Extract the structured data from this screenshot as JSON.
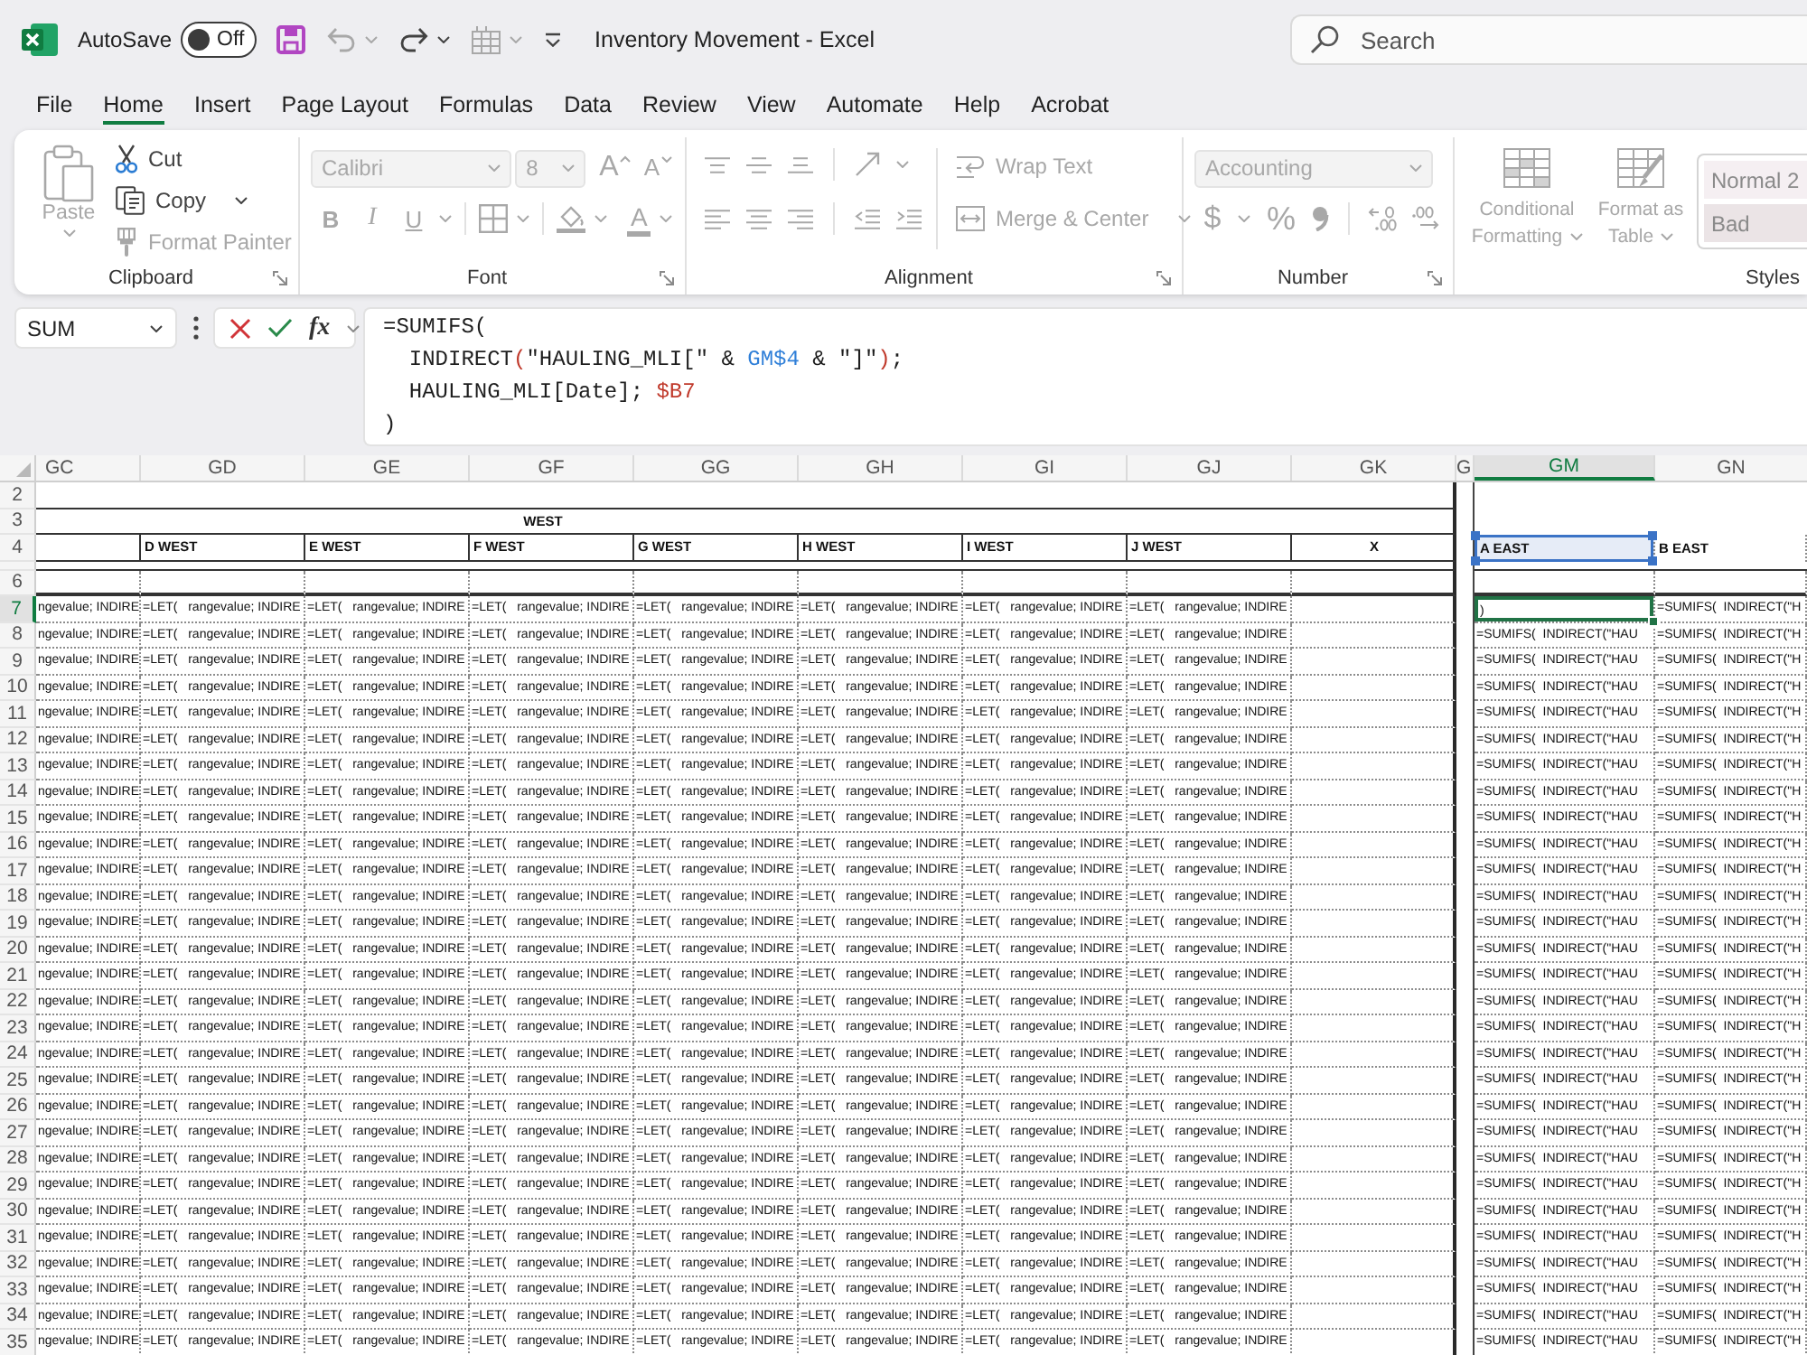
{
  "title_bar": {
    "autosave": {
      "label": "AutoSave",
      "on": false,
      "state_label": "Off"
    },
    "quick_access": [
      {
        "kind": "save",
        "disabled": false
      },
      {
        "kind": "undo",
        "disabled": true
      },
      {
        "kind": "redo",
        "disabled": false
      },
      {
        "kind": "table",
        "disabled": true
      },
      {
        "kind": "customize",
        "disabled": false
      }
    ],
    "title": "Inventory Movement - Excel",
    "search": {
      "placeholder": "Search"
    }
  },
  "menu_tabs": [
    {
      "label": "File",
      "selected": false
    },
    {
      "label": "Home",
      "selected": true
    },
    {
      "label": "Insert",
      "selected": false
    },
    {
      "label": "Page Layout",
      "selected": false
    },
    {
      "label": "Formulas",
      "selected": false
    },
    {
      "label": "Data",
      "selected": false
    },
    {
      "label": "Review",
      "selected": false
    },
    {
      "label": "View",
      "selected": false
    },
    {
      "label": "Automate",
      "selected": false
    },
    {
      "label": "Help",
      "selected": false
    },
    {
      "label": "Acrobat",
      "selected": false
    }
  ],
  "ribbon": {
    "clipboard": {
      "label": "Clipboard",
      "paste": {
        "label": "Paste",
        "disabled": true
      },
      "cut": {
        "label": "Cut",
        "disabled": false
      },
      "copy": {
        "label": "Copy",
        "disabled": false
      },
      "format_painter": {
        "label": "Format Painter",
        "disabled": true
      }
    },
    "font": {
      "label": "Font",
      "font_name": {
        "value": "Calibri",
        "disabled": true
      },
      "font_size": {
        "value": "8",
        "disabled": true
      },
      "size_buttons": [
        {
          "kind": "grow",
          "label": "A",
          "disabled": true
        },
        {
          "kind": "shrink",
          "label": "A",
          "disabled": true
        }
      ],
      "style_buttons": [
        {
          "kind": "bold",
          "label": "B",
          "disabled": true
        },
        {
          "kind": "italic",
          "label": "I",
          "disabled": true
        },
        {
          "kind": "underline",
          "label": "U",
          "disabled": true
        }
      ],
      "tools": [
        {
          "kind": "borders",
          "disabled": true
        },
        {
          "kind": "fill_color",
          "disabled": true
        }
      ],
      "font_color": {
        "label": "A",
        "disabled": true
      }
    },
    "alignment": {
      "label": "Alignment",
      "tool_rows": [
        [
          {
            "kind": "align_top",
            "disabled": true
          },
          {
            "kind": "align_middle",
            "disabled": true
          },
          {
            "kind": "align_bottom",
            "disabled": true
          },
          {
            "kind": "orientation",
            "disabled": true
          }
        ],
        [
          {
            "kind": "align_left",
            "disabled": true
          },
          {
            "kind": "align_center",
            "disabled": true
          },
          {
            "kind": "align_right",
            "disabled": true
          },
          {
            "kind": "decrease_indent",
            "disabled": true
          },
          {
            "kind": "increase_indent",
            "disabled": true
          }
        ]
      ],
      "wrap_text": {
        "label": "Wrap Text",
        "disabled": true
      },
      "merge_center": {
        "label": "Merge & Center",
        "disabled": true
      }
    },
    "number": {
      "label": "Number",
      "format": {
        "value": "Accounting",
        "disabled": true
      },
      "currency": {
        "label": "$",
        "disabled": true
      },
      "percent": {
        "label": "%",
        "disabled": true
      },
      "tools": [
        {
          "kind": "comma",
          "disabled": true
        },
        {
          "kind": "increase_decimal",
          "disabled": true
        },
        {
          "kind": "decrease_decimal",
          "disabled": true
        }
      ]
    },
    "styles": {
      "label": "Styles",
      "conditional_formatting": {
        "label": "Conditional Formatting",
        "disabled": true
      },
      "format_as_table": {
        "label": "Format as Table",
        "disabled": true
      },
      "gallery": [
        {
          "label": "Normal 2",
          "color": "#f5eff2",
          "disabled": true
        },
        {
          "label": "Bad",
          "color": "#ebe4e6",
          "disabled": true
        }
      ]
    }
  },
  "formula_bar": {
    "name_box": "SUM",
    "function_label": "fx",
    "lines": [
      [
        {
          "text": "=SUMIFS(",
          "color": "#1e1e1e"
        }
      ],
      [
        {
          "text": "  INDIRECT",
          "color": "#1e1e1e"
        },
        {
          "text": "(",
          "color": "#c0392b"
        },
        {
          "text": "\"HAULING_MLI[\" & ",
          "color": "#1e1e1e"
        },
        {
          "text": "GM$4",
          "color": "#2f7fd8"
        },
        {
          "text": " & \"]\"",
          "color": "#1e1e1e"
        },
        {
          "text": ")",
          "color": "#c0392b"
        },
        {
          "text": ";",
          "color": "#1e1e1e"
        }
      ],
      [
        {
          "text": "  HAULING_MLI[Date]; ",
          "color": "#1e1e1e"
        },
        {
          "text": "$B7",
          "color": "#c0392b"
        }
      ],
      [
        {
          "text": ")",
          "color": "#1e1e1e"
        }
      ]
    ]
  },
  "sheet": {
    "group_title": "WEST",
    "columns": [
      {
        "label": "GC",
        "selected": false,
        "cells": [
          "ngevalue; INDIRE",
          "ngevalue; INDIRE",
          "ngevalue; INDIRE",
          "ngevalue; INDIRE",
          "ngevalue; INDIRE",
          "ngevalue; INDIRE",
          "ngevalue; INDIRE",
          "ngevalue; INDIRE",
          "ngevalue; INDIRE",
          "ngevalue; INDIRE",
          "ngevalue; INDIRE",
          "ngevalue; INDIRE",
          "ngevalue; INDIRE",
          "ngevalue; INDIRE",
          "ngevalue; INDIRE",
          "ngevalue; INDIRE",
          "ngevalue; INDIRE",
          "ngevalue; INDIRE",
          "ngevalue; INDIRE",
          "ngevalue; INDIRE",
          "ngevalue; INDIRE",
          "ngevalue; INDIRE",
          "ngevalue; INDIRE",
          "ngevalue; INDIRE",
          "ngevalue; INDIRE",
          "ngevalue; INDIRE",
          "ngevalue; INDIRE",
          "ngevalue; INDIRE",
          "ngevalue; INDIRE"
        ]
      },
      {
        "label": "GD",
        "selected": false,
        "header": {
          "text": "D WEST",
          "referenced": false
        },
        "cells": [
          "=LET(   rangevalue; INDIRE",
          "=LET(   rangevalue; INDIRE",
          "=LET(   rangevalue; INDIRE",
          "=LET(   rangevalue; INDIRE",
          "=LET(   rangevalue; INDIRE",
          "=LET(   rangevalue; INDIRE",
          "=LET(   rangevalue; INDIRE",
          "=LET(   rangevalue; INDIRE",
          "=LET(   rangevalue; INDIRE",
          "=LET(   rangevalue; INDIRE",
          "=LET(   rangevalue; INDIRE",
          "=LET(   rangevalue; INDIRE",
          "=LET(   rangevalue; INDIRE",
          "=LET(   rangevalue; INDIRE",
          "=LET(   rangevalue; INDIRE",
          "=LET(   rangevalue; INDIRE",
          "=LET(   rangevalue; INDIRE",
          "=LET(   rangevalue; INDIRE",
          "=LET(   rangevalue; INDIRE",
          "=LET(   rangevalue; INDIRE",
          "=LET(   rangevalue; INDIRE",
          "=LET(   rangevalue; INDIRE",
          "=LET(   rangevalue; INDIRE",
          "=LET(   rangevalue; INDIRE",
          "=LET(   rangevalue; INDIRE",
          "=LET(   rangevalue; INDIRE",
          "=LET(   rangevalue; INDIRE",
          "=LET(   rangevalue; INDIRE",
          "=LET(   rangevalue; INDIRE"
        ]
      },
      {
        "label": "GE",
        "selected": false,
        "header": {
          "text": "E WEST",
          "referenced": false
        },
        "cells": [
          "=LET(   rangevalue; INDIRE",
          "=LET(   rangevalue; INDIRE",
          "=LET(   rangevalue; INDIRE",
          "=LET(   rangevalue; INDIRE",
          "=LET(   rangevalue; INDIRE",
          "=LET(   rangevalue; INDIRE",
          "=LET(   rangevalue; INDIRE",
          "=LET(   rangevalue; INDIRE",
          "=LET(   rangevalue; INDIRE",
          "=LET(   rangevalue; INDIRE",
          "=LET(   rangevalue; INDIRE",
          "=LET(   rangevalue; INDIRE",
          "=LET(   rangevalue; INDIRE",
          "=LET(   rangevalue; INDIRE",
          "=LET(   rangevalue; INDIRE",
          "=LET(   rangevalue; INDIRE",
          "=LET(   rangevalue; INDIRE",
          "=LET(   rangevalue; INDIRE",
          "=LET(   rangevalue; INDIRE",
          "=LET(   rangevalue; INDIRE",
          "=LET(   rangevalue; INDIRE",
          "=LET(   rangevalue; INDIRE",
          "=LET(   rangevalue; INDIRE",
          "=LET(   rangevalue; INDIRE",
          "=LET(   rangevalue; INDIRE",
          "=LET(   rangevalue; INDIRE",
          "=LET(   rangevalue; INDIRE",
          "=LET(   rangevalue; INDIRE",
          "=LET(   rangevalue; INDIRE"
        ]
      },
      {
        "label": "GF",
        "selected": false,
        "header": {
          "text": "F WEST",
          "referenced": false
        },
        "cells": [
          "=LET(   rangevalue; INDIRE",
          "=LET(   rangevalue; INDIRE",
          "=LET(   rangevalue; INDIRE",
          "=LET(   rangevalue; INDIRE",
          "=LET(   rangevalue; INDIRE",
          "=LET(   rangevalue; INDIRE",
          "=LET(   rangevalue; INDIRE",
          "=LET(   rangevalue; INDIRE",
          "=LET(   rangevalue; INDIRE",
          "=LET(   rangevalue; INDIRE",
          "=LET(   rangevalue; INDIRE",
          "=LET(   rangevalue; INDIRE",
          "=LET(   rangevalue; INDIRE",
          "=LET(   rangevalue; INDIRE",
          "=LET(   rangevalue; INDIRE",
          "=LET(   rangevalue; INDIRE",
          "=LET(   rangevalue; INDIRE",
          "=LET(   rangevalue; INDIRE",
          "=LET(   rangevalue; INDIRE",
          "=LET(   rangevalue; INDIRE",
          "=LET(   rangevalue; INDIRE",
          "=LET(   rangevalue; INDIRE",
          "=LET(   rangevalue; INDIRE",
          "=LET(   rangevalue; INDIRE",
          "=LET(   rangevalue; INDIRE",
          "=LET(   rangevalue; INDIRE",
          "=LET(   rangevalue; INDIRE",
          "=LET(   rangevalue; INDIRE",
          "=LET(   rangevalue; INDIRE"
        ]
      },
      {
        "label": "GG",
        "selected": false,
        "header": {
          "text": "G WEST",
          "referenced": false
        },
        "cells": [
          "=LET(   rangevalue; INDIRE",
          "=LET(   rangevalue; INDIRE",
          "=LET(   rangevalue; INDIRE",
          "=LET(   rangevalue; INDIRE",
          "=LET(   rangevalue; INDIRE",
          "=LET(   rangevalue; INDIRE",
          "=LET(   rangevalue; INDIRE",
          "=LET(   rangevalue; INDIRE",
          "=LET(   rangevalue; INDIRE",
          "=LET(   rangevalue; INDIRE",
          "=LET(   rangevalue; INDIRE",
          "=LET(   rangevalue; INDIRE",
          "=LET(   rangevalue; INDIRE",
          "=LET(   rangevalue; INDIRE",
          "=LET(   rangevalue; INDIRE",
          "=LET(   rangevalue; INDIRE",
          "=LET(   rangevalue; INDIRE",
          "=LET(   rangevalue; INDIRE",
          "=LET(   rangevalue; INDIRE",
          "=LET(   rangevalue; INDIRE",
          "=LET(   rangevalue; INDIRE",
          "=LET(   rangevalue; INDIRE",
          "=LET(   rangevalue; INDIRE",
          "=LET(   rangevalue; INDIRE",
          "=LET(   rangevalue; INDIRE",
          "=LET(   rangevalue; INDIRE",
          "=LET(   rangevalue; INDIRE",
          "=LET(   rangevalue; INDIRE",
          "=LET(   rangevalue; INDIRE"
        ]
      },
      {
        "label": "GH",
        "selected": false,
        "header": {
          "text": "H WEST",
          "referenced": false
        },
        "cells": [
          "=LET(   rangevalue; INDIRE",
          "=LET(   rangevalue; INDIRE",
          "=LET(   rangevalue; INDIRE",
          "=LET(   rangevalue; INDIRE",
          "=LET(   rangevalue; INDIRE",
          "=LET(   rangevalue; INDIRE",
          "=LET(   rangevalue; INDIRE",
          "=LET(   rangevalue; INDIRE",
          "=LET(   rangevalue; INDIRE",
          "=LET(   rangevalue; INDIRE",
          "=LET(   rangevalue; INDIRE",
          "=LET(   rangevalue; INDIRE",
          "=LET(   rangevalue; INDIRE",
          "=LET(   rangevalue; INDIRE",
          "=LET(   rangevalue; INDIRE",
          "=LET(   rangevalue; INDIRE",
          "=LET(   rangevalue; INDIRE",
          "=LET(   rangevalue; INDIRE",
          "=LET(   rangevalue; INDIRE",
          "=LET(   rangevalue; INDIRE",
          "=LET(   rangevalue; INDIRE",
          "=LET(   rangevalue; INDIRE",
          "=LET(   rangevalue; INDIRE",
          "=LET(   rangevalue; INDIRE",
          "=LET(   rangevalue; INDIRE",
          "=LET(   rangevalue; INDIRE",
          "=LET(   rangevalue; INDIRE",
          "=LET(   rangevalue; INDIRE",
          "=LET(   rangevalue; INDIRE"
        ]
      },
      {
        "label": "GI",
        "selected": false,
        "header": {
          "text": "I WEST",
          "referenced": false
        },
        "cells": [
          "=LET(   rangevalue; INDIRE",
          "=LET(   rangevalue; INDIRE",
          "=LET(   rangevalue; INDIRE",
          "=LET(   rangevalue; INDIRE",
          "=LET(   rangevalue; INDIRE",
          "=LET(   rangevalue; INDIRE",
          "=LET(   rangevalue; INDIRE",
          "=LET(   rangevalue; INDIRE",
          "=LET(   rangevalue; INDIRE",
          "=LET(   rangevalue; INDIRE",
          "=LET(   rangevalue; INDIRE",
          "=LET(   rangevalue; INDIRE",
          "=LET(   rangevalue; INDIRE",
          "=LET(   rangevalue; INDIRE",
          "=LET(   rangevalue; INDIRE",
          "=LET(   rangevalue; INDIRE",
          "=LET(   rangevalue; INDIRE",
          "=LET(   rangevalue; INDIRE",
          "=LET(   rangevalue; INDIRE",
          "=LET(   rangevalue; INDIRE",
          "=LET(   rangevalue; INDIRE",
          "=LET(   rangevalue; INDIRE",
          "=LET(   rangevalue; INDIRE",
          "=LET(   rangevalue; INDIRE",
          "=LET(   rangevalue; INDIRE",
          "=LET(   rangevalue; INDIRE",
          "=LET(   rangevalue; INDIRE",
          "=LET(   rangevalue; INDIRE",
          "=LET(   rangevalue; INDIRE"
        ]
      },
      {
        "label": "GJ",
        "selected": false,
        "header": {
          "text": "J WEST",
          "referenced": false
        },
        "cells": [
          "=LET(   rangevalue; INDIRE",
          "=LET(   rangevalue; INDIRE",
          "=LET(   rangevalue; INDIRE",
          "=LET(   rangevalue; INDIRE",
          "=LET(   rangevalue; INDIRE",
          "=LET(   rangevalue; INDIRE",
          "=LET(   rangevalue; INDIRE",
          "=LET(   rangevalue; INDIRE",
          "=LET(   rangevalue; INDIRE",
          "=LET(   rangevalue; INDIRE",
          "=LET(   rangevalue; INDIRE",
          "=LET(   rangevalue; INDIRE",
          "=LET(   rangevalue; INDIRE",
          "=LET(   rangevalue; INDIRE",
          "=LET(   rangevalue; INDIRE",
          "=LET(   rangevalue; INDIRE",
          "=LET(   rangevalue; INDIRE",
          "=LET(   rangevalue; INDIRE",
          "=LET(   rangevalue; INDIRE",
          "=LET(   rangevalue; INDIRE",
          "=LET(   rangevalue; INDIRE",
          "=LET(   rangevalue; INDIRE",
          "=LET(   rangevalue; INDIRE",
          "=LET(   rangevalue; INDIRE",
          "=LET(   rangevalue; INDIRE",
          "=LET(   rangevalue; INDIRE",
          "=LET(   rangevalue; INDIRE",
          "=LET(   rangevalue; INDIRE",
          "=LET(   rangevalue; INDIRE"
        ]
      },
      {
        "label": "GK",
        "selected": false,
        "header": {
          "text": "X",
          "referenced": false
        }
      },
      {
        "label": "G",
        "selected": false
      },
      {
        "label": "GM",
        "selected": true,
        "header": {
          "text": "A EAST",
          "referenced": true
        },
        "cells": [
          ")",
          "=SUMIFS(  INDIRECT(\"HAU",
          "=SUMIFS(  INDIRECT(\"HAU",
          "=SUMIFS(  INDIRECT(\"HAU",
          "=SUMIFS(  INDIRECT(\"HAU",
          "=SUMIFS(  INDIRECT(\"HAU",
          "=SUMIFS(  INDIRECT(\"HAU",
          "=SUMIFS(  INDIRECT(\"HAU",
          "=SUMIFS(  INDIRECT(\"HAU",
          "=SUMIFS(  INDIRECT(\"HAU",
          "=SUMIFS(  INDIRECT(\"HAU",
          "=SUMIFS(  INDIRECT(\"HAU",
          "=SUMIFS(  INDIRECT(\"HAU",
          "=SUMIFS(  INDIRECT(\"HAU",
          "=SUMIFS(  INDIRECT(\"HAU",
          "=SUMIFS(  INDIRECT(\"HAU",
          "=SUMIFS(  INDIRECT(\"HAU",
          "=SUMIFS(  INDIRECT(\"HAU",
          "=SUMIFS(  INDIRECT(\"HAU",
          "=SUMIFS(  INDIRECT(\"HAU",
          "=SUMIFS(  INDIRECT(\"HAU",
          "=SUMIFS(  INDIRECT(\"HAU",
          "=SUMIFS(  INDIRECT(\"HAU",
          "=SUMIFS(  INDIRECT(\"HAU",
          "=SUMIFS(  INDIRECT(\"HAU",
          "=SUMIFS(  INDIRECT(\"HAU",
          "=SUMIFS(  INDIRECT(\"HAU",
          "=SUMIFS(  INDIRECT(\"HAU",
          "=SUMIFS(  INDIRECT(\"HAU"
        ]
      },
      {
        "label": "GN",
        "selected": false,
        "header": {
          "text": "B EAST",
          "referenced": false
        },
        "cells": [
          "=SUMIFS(  INDIRECT(\"H",
          "=SUMIFS(  INDIRECT(\"H",
          "=SUMIFS(  INDIRECT(\"H",
          "=SUMIFS(  INDIRECT(\"H",
          "=SUMIFS(  INDIRECT(\"H",
          "=SUMIFS(  INDIRECT(\"H",
          "=SUMIFS(  INDIRECT(\"H",
          "=SUMIFS(  INDIRECT(\"H",
          "=SUMIFS(  INDIRECT(\"H",
          "=SUMIFS(  INDIRECT(\"H",
          "=SUMIFS(  INDIRECT(\"H",
          "=SUMIFS(  INDIRECT(\"H",
          "=SUMIFS(  INDIRECT(\"H",
          "=SUMIFS(  INDIRECT(\"H",
          "=SUMIFS(  INDIRECT(\"H",
          "=SUMIFS(  INDIRECT(\"H",
          "=SUMIFS(  INDIRECT(\"H",
          "=SUMIFS(  INDIRECT(\"H",
          "=SUMIFS(  INDIRECT(\"H",
          "=SUMIFS(  INDIRECT(\"H",
          "=SUMIFS(  INDIRECT(\"H",
          "=SUMIFS(  INDIRECT(\"H",
          "=SUMIFS(  INDIRECT(\"H",
          "=SUMIFS(  INDIRECT(\"H",
          "=SUMIFS(  INDIRECT(\"H",
          "=SUMIFS(  INDIRECT(\"H",
          "=SUMIFS(  INDIRECT(\"H",
          "=SUMIFS(  INDIRECT(\"H",
          "=SUMIFS(  INDIRECT(\"H"
        ]
      }
    ],
    "rows": [
      {
        "number": "2",
        "kind": "blank",
        "selected": false
      },
      {
        "number": "3",
        "kind": "title",
        "selected": false
      },
      {
        "number": "4",
        "kind": "header",
        "selected": false
      },
      {
        "kind": "collapsed",
        "selected": false
      },
      {
        "number": "6",
        "kind": "blank",
        "selected": false
      },
      {
        "number": "7",
        "kind": "data",
        "selected": true
      },
      {
        "number": "8",
        "kind": "data",
        "selected": false
      },
      {
        "number": "9",
        "kind": "data",
        "selected": false
      },
      {
        "number": "10",
        "kind": "data",
        "selected": false
      },
      {
        "number": "11",
        "kind": "data",
        "selected": false
      },
      {
        "number": "12",
        "kind": "data",
        "selected": false
      },
      {
        "number": "13",
        "kind": "data",
        "selected": false
      },
      {
        "number": "14",
        "kind": "data",
        "selected": false
      },
      {
        "number": "15",
        "kind": "data",
        "selected": false
      },
      {
        "number": "16",
        "kind": "data",
        "selected": false
      },
      {
        "number": "17",
        "kind": "data",
        "selected": false
      },
      {
        "number": "18",
        "kind": "data",
        "selected": false
      },
      {
        "number": "19",
        "kind": "data",
        "selected": false
      },
      {
        "number": "20",
        "kind": "data",
        "selected": false
      },
      {
        "number": "21",
        "kind": "data",
        "selected": false
      },
      {
        "number": "22",
        "kind": "data",
        "selected": false
      },
      {
        "number": "23",
        "kind": "data",
        "selected": false
      },
      {
        "number": "24",
        "kind": "data",
        "selected": false
      },
      {
        "number": "25",
        "kind": "data",
        "selected": false
      },
      {
        "number": "26",
        "kind": "data",
        "selected": false
      },
      {
        "number": "27",
        "kind": "data",
        "selected": false
      },
      {
        "number": "28",
        "kind": "data",
        "selected": false
      },
      {
        "number": "29",
        "kind": "data",
        "selected": false
      },
      {
        "number": "30",
        "kind": "data",
        "selected": false
      },
      {
        "number": "31",
        "kind": "data",
        "selected": false
      },
      {
        "number": "32",
        "kind": "data",
        "selected": false
      },
      {
        "number": "33",
        "kind": "data",
        "selected": false
      },
      {
        "number": "34",
        "kind": "data",
        "selected": false
      },
      {
        "number": "35",
        "kind": "data",
        "selected": false
      }
    ]
  }
}
